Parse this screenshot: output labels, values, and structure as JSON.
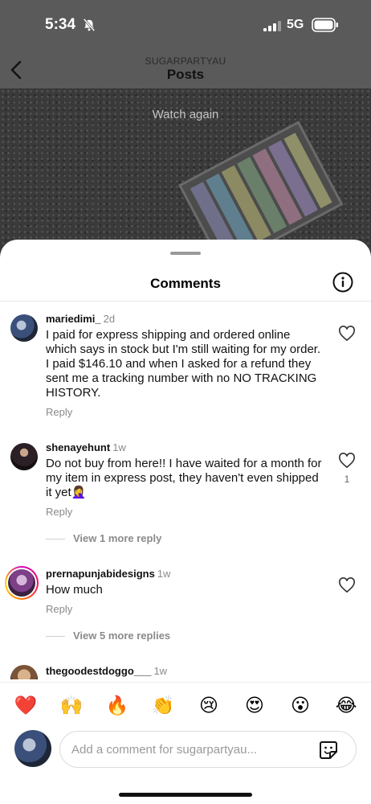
{
  "status_bar": {
    "time": "5:34",
    "network": "5G"
  },
  "nav": {
    "account": "SUGARPARTYAU",
    "title": "Posts"
  },
  "post": {
    "overlay_text": "Watch again"
  },
  "sheet": {
    "title": "Comments"
  },
  "comments": [
    {
      "user": "mariedimi_",
      "time": "2d",
      "text": "I paid for express shipping and ordered online which says in stock but I'm still waiting for my order. I paid $146.10 and when I asked for a refund they sent me a tracking number with no NO TRACKING HISTORY.",
      "reply": "Reply"
    },
    {
      "user": "shenayehunt",
      "time": "1w",
      "text": "Do not buy from here!! I have waited for a month for my item in express post, they haven't even shipped it yet🤦‍♀️",
      "reply": "Reply",
      "likes": "1",
      "more_replies": "View 1 more reply"
    },
    {
      "user": "prernapunjabidesigns",
      "time": "1w",
      "text": "How much",
      "reply": "Reply",
      "more_replies": "View 5 more replies"
    },
    {
      "user": "thegoodestdoggo___",
      "time": "1w"
    }
  ],
  "emoji_bar": [
    "❤️",
    "🙌",
    "🔥",
    "👏",
    "😢",
    "😍",
    "😮",
    "😂"
  ],
  "composer": {
    "placeholder": "Add a comment for sugarpartyau..."
  },
  "colors": {
    "accent_ring": "#d300c5",
    "heart_red": "#e0245e"
  }
}
